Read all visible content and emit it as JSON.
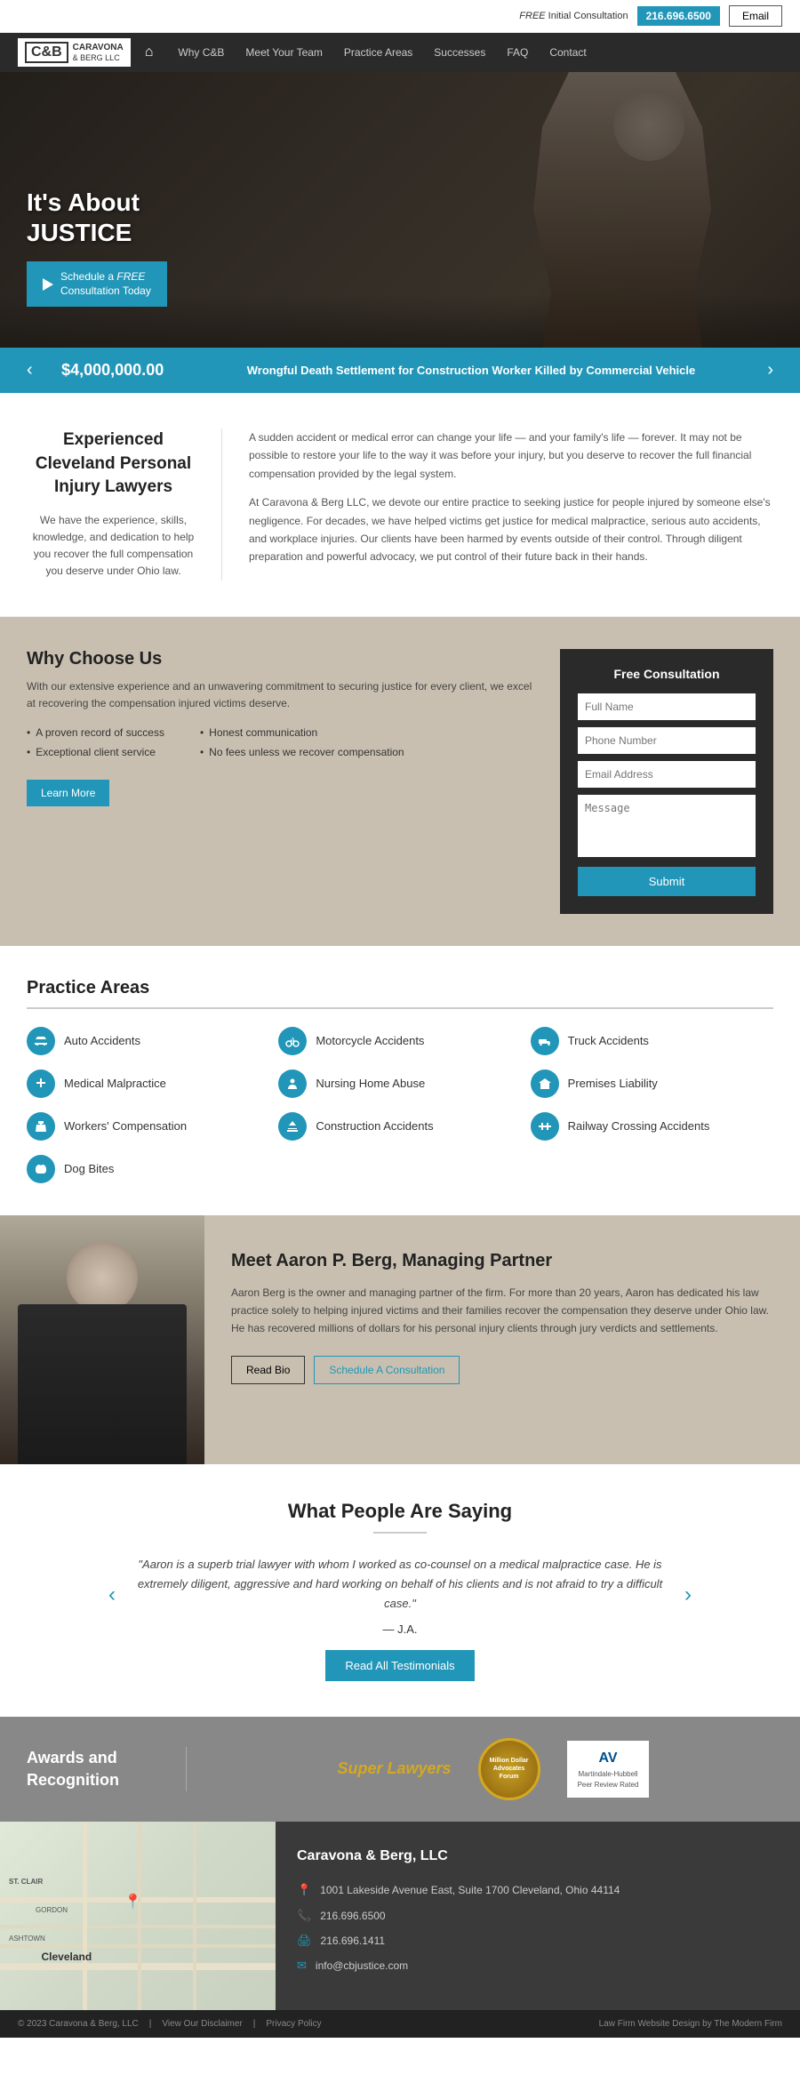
{
  "topbar": {
    "free_label": "FREE",
    "consultation_text": " Initial Consultation",
    "phone": "216.696.6500",
    "email_btn": "Email"
  },
  "nav": {
    "logo_cb": "C&B",
    "logo_name1": "CARAVONA",
    "logo_name2": "& BERG LLC",
    "items": [
      {
        "label": "Why C&B",
        "id": "why"
      },
      {
        "label": "Meet Your Team",
        "id": "team"
      },
      {
        "label": "Practice Areas",
        "id": "practice"
      },
      {
        "label": "Successes",
        "id": "successes"
      },
      {
        "label": "FAQ",
        "id": "faq"
      },
      {
        "label": "Contact",
        "id": "contact"
      }
    ]
  },
  "hero": {
    "title_line1": "It's About",
    "title_line2": "JUSTICE",
    "btn_free": "FREE",
    "btn_text1": "Schedule a ",
    "btn_text2": " Consultation Today"
  },
  "slider": {
    "amount": "$4,000,000.00",
    "text": "Wrongful Death Settlement for Construction Worker\nKilled by Commercial Vehicle",
    "prev": "‹",
    "next": "›"
  },
  "intro": {
    "heading": "Experienced Cleveland Personal Injury Lawyers",
    "subtext": "We have the experience, skills, knowledge, and dedication to help you recover the full compensation you deserve under Ohio law.",
    "para1": "A sudden accident or medical error can change your life — and your family's life — forever. It may not be possible to restore your life to the way it was before your injury, but you deserve to recover the full financial compensation provided by the legal system.",
    "para2": "At Caravona & Berg LLC, we devote our entire practice to seeking justice for people injured by someone else's negligence. For decades, we have helped victims get justice for medical malpractice, serious auto accidents, and workplace injuries. Our clients have been harmed by events outside of their control. Through diligent preparation and powerful advocacy, we put control of their future back in their hands."
  },
  "why": {
    "heading": "Why Choose Us",
    "description": "With our extensive experience and an unwavering commitment to securing justice for every client, we excel at recovering the compensation injured victims deserve.",
    "list_left": [
      "A proven record of success",
      "Exceptional client service"
    ],
    "list_right": [
      "Honest communication",
      "No fees unless we recover compensation"
    ],
    "learn_more": "Learn More"
  },
  "form": {
    "title": "Free Consultation",
    "full_name_placeholder": "Full Name",
    "phone_placeholder": "Phone Number",
    "email_placeholder": "Email Address",
    "message_placeholder": "Message",
    "submit": "Submit"
  },
  "practice": {
    "heading": "Practice Areas",
    "items": [
      {
        "label": "Auto Accidents",
        "col": 0
      },
      {
        "label": "Motorcycle Accidents",
        "col": 1
      },
      {
        "label": "Truck Accidents",
        "col": 2
      },
      {
        "label": "Medical Malpractice",
        "col": 0
      },
      {
        "label": "Nursing Home Abuse",
        "col": 1
      },
      {
        "label": "Premises Liability",
        "col": 2
      },
      {
        "label": "Workers' Compensation",
        "col": 0
      },
      {
        "label": "Construction Accidents",
        "col": 1
      },
      {
        "label": "Railway Crossing Accidents",
        "col": 2
      },
      {
        "label": "Dog Bites",
        "col": 0
      }
    ]
  },
  "team": {
    "heading": "Meet Aaron P. Berg, Managing Partner",
    "bio": "Aaron Berg is the owner and managing partner of the firm. For more than 20 years, Aaron has dedicated his law practice solely to helping injured victims and their families recover the compensation they deserve under Ohio law. He has recovered millions of dollars for his personal injury clients through jury verdicts and settlements.",
    "read_bio": "Read Bio",
    "schedule": "Schedule A Consultation"
  },
  "testimonials": {
    "heading": "What People Are Saying",
    "quote": "\"Aaron is a superb trial lawyer with whom I worked as co-counsel on a medical malpractice case. He is extremely diligent, aggressive and hard working on behalf of his clients and is not afraid to try a difficult case.\"",
    "attribution": "— J.A.",
    "read_all": "Read All Testimonials",
    "prev": "‹",
    "next": "›"
  },
  "awards": {
    "heading": "Awards and Recognition",
    "super_lawyers": "Super Lawyers",
    "badge_text": "Million Dollar\nAdvocates\nForum",
    "av_title": "AV",
    "av_line1": "Martindale-Hubbell",
    "av_line2": "Peer Review Rated"
  },
  "footer": {
    "company": "Caravona & Berg, LLC",
    "address": "1001 Lakeside Avenue East, Suite 1700 Cleveland, Ohio 44114",
    "phone": "216.696.6500",
    "fax": "216.696.1411",
    "email": "info@cbjustice.com",
    "map_label": "Cleveland"
  },
  "footer_bottom": {
    "copyright": "© 2023 Caravona & Berg, LLC",
    "disclaimer": "View Our Disclaimer",
    "privacy": "Privacy Policy",
    "credit": "Law Firm Website Design by The Modern Firm"
  }
}
